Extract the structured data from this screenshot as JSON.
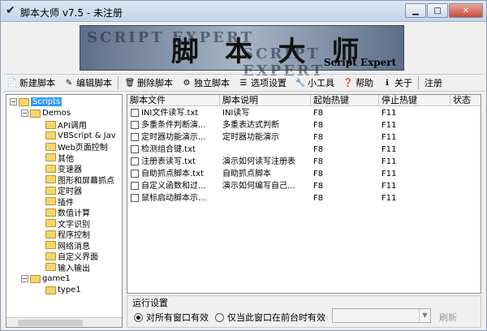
{
  "window": {
    "title": "脚本大师 v7.5 - 未注册"
  },
  "banner": {
    "main": "脚 本 大 师",
    "watermark": "SCRIPT EXPERT",
    "sub": "Script Expert"
  },
  "toolbar": {
    "new": "新建脚本",
    "edit": "编辑脚本",
    "delete": "删除脚本",
    "standalone": "独立脚本",
    "options": "选项设置",
    "tools": "小工具",
    "help": "帮助",
    "about": "关于",
    "register": "注册"
  },
  "tree": {
    "root": "Scripts",
    "demos": "Demos",
    "demo_items": [
      "API调用",
      "VBScript & Jav",
      "Web页面控制",
      "其他",
      "变速器",
      "图形和屏幕抓点",
      "定时器",
      "插件",
      "数值计算",
      "文字识别",
      "程序控制",
      "网络消息",
      "自定义界面",
      "输入输出"
    ],
    "game1": "game1",
    "game1_items": [
      "type1"
    ]
  },
  "list": {
    "headers": [
      "脚本文件",
      "脚本说明",
      "起始热键",
      "停止热键",
      "状态"
    ],
    "rows": [
      {
        "file": "INI文件读写.txt",
        "desc": "INI读写",
        "start": "F8",
        "stop": "F11"
      },
      {
        "file": "多重条件判断演...",
        "desc": "多重表达式判断",
        "start": "F8",
        "stop": "F11"
      },
      {
        "file": "定时器功能演示...",
        "desc": "定时器功能演示",
        "start": "F8",
        "stop": "F11"
      },
      {
        "file": "检测组合键.txt",
        "desc": "",
        "start": "F8",
        "stop": "F11"
      },
      {
        "file": "注册表读写.txt",
        "desc": "演示如何读写注册表",
        "start": "F8",
        "stop": "F11"
      },
      {
        "file": "自助抓点脚本.txt",
        "desc": "自助抓点脚本",
        "start": "F8",
        "stop": "F11"
      },
      {
        "file": "自定义函数和过...",
        "desc": "演示如何编写自己...",
        "start": "F8",
        "stop": "F11"
      },
      {
        "file": "鼠标启动脚本示...",
        "desc": "",
        "start": "F8",
        "stop": "F11"
      }
    ]
  },
  "run": {
    "label": "运行设置",
    "opt_all": "对所有窗口有效",
    "opt_fg": "仅当此窗口在前台时有效",
    "refresh": "刷新"
  }
}
